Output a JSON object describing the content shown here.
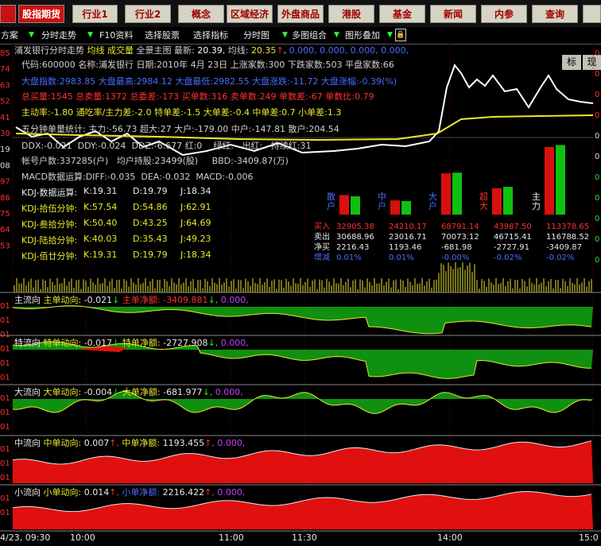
{
  "toolbar": {
    "buttons": [
      "股指期货",
      "行业1",
      "行业2",
      "概念",
      "区域经济",
      "外盘商品",
      "港股",
      "基金",
      "新闻",
      "内参",
      "查询"
    ]
  },
  "menubar": {
    "items": [
      "方案",
      "分时走势",
      "F10资料",
      "选择股票",
      "选择指标",
      "分时图",
      "多图组合",
      "图形叠加"
    ],
    "right_tabs": [
      "标",
      "现"
    ]
  },
  "chart_header": {
    "name": "浦发银行分时走势",
    "labels": [
      "均线",
      "成交量",
      "全景主图"
    ],
    "latest_label": "最新:",
    "latest": "20.39",
    "avg_label": "均线:",
    "avg": "20.35",
    "extra": "0.000, 0.000, 0.000, 0.000,"
  },
  "info_lines": {
    "l1": {
      "code_label": "代码:",
      "code": "600000",
      "name_label": "名称:",
      "name": "浦发银行",
      "date_label": "日期:",
      "date": "2010年 4月 23日",
      "up_label": "上涨家数:",
      "up": "300",
      "down_label": "下跌家数:",
      "down": "503",
      "flat_label": "平盘家数:",
      "flat": "66"
    },
    "l2": {
      "idx_label": "大盘指数:",
      "idx": "2983.85",
      "hi_label": "大盘最高:",
      "hi": "2984.12",
      "lo_label": "大盘最低:",
      "lo": "2982.55",
      "chg_label": "大盘涨跌:",
      "chg": "-11.72",
      "pct_label": "大盘涨幅:",
      "pct": "-0.39(%)"
    },
    "l3": {
      "tb_label": "总买量:",
      "tb": "1545",
      "ts_label": "总卖量:",
      "ts": "1372",
      "tc_label": "总委差:",
      "tc": "-173",
      "bc_label": "买单数:",
      "bc": "316",
      "sc_label": "卖单数:",
      "sc": "249",
      "dc_label": "单数差:",
      "dc": "-67",
      "dr_label": "单数比:",
      "dr": "0.79"
    },
    "l4": {
      "a_label": "主动率:",
      "a": "-1.80",
      "b_label": "通吃率/主力差:",
      "b": "-2.0",
      "c_label": "特单差:",
      "c": "-1.5",
      "d_label": "大单差:",
      "d": "-0.4",
      "e_label": "中单差:",
      "e": "0.7",
      "f_label": "小单差:",
      "f": "1.3"
    },
    "l5": {
      "text": "五分钟单量统计: 主力:",
      "v1": "-56.73",
      "mid": "超大:",
      "v2": "27",
      "big": "大户:",
      "v3": "-179.00",
      "midh": "中户:",
      "v4": "-147.81",
      "small": "散户:",
      "v5": "204.54"
    },
    "l6": {
      "ddx_label": "DDX:",
      "ddx": "-0.021",
      "ddy_label": "DDY:",
      "ddy": "-0.024",
      "ddz_label": "DDZ:",
      "ddz": "-6.677",
      "t1": "红:0",
      "t2": "绿红:",
      "t3": "出红:",
      "t4": "持续红:31"
    },
    "l7": {
      "acc_label": "帐号户数:",
      "acc": "337285(户)",
      "avg_label": "均户持股:",
      "avg": "23499(股)",
      "bbd_label": "BBD:",
      "bbd": "-3409.87(万)"
    },
    "l8": {
      "label": "MACD数据运算:",
      "diff_label": "DIFF:",
      "diff": "-0.035",
      "dea_label": "DEA:",
      "dea": "-0.032",
      "macd_label": "MACD:",
      "macd": "-0.006"
    },
    "kdj": [
      {
        "label": "KDJ-数据运算:",
        "k": "K:19.31",
        "d": "D:19.79",
        "j": "J:18.34"
      },
      {
        "label": "KDJ-拾伍分钟:",
        "k": "K:57.54",
        "d": "D:54.86",
        "j": "J:62.91"
      },
      {
        "label": "KDJ-叁拾分钟:",
        "k": "K:50.40",
        "d": "D:43.25",
        "j": "J:64.69"
      },
      {
        "label": "KDJ-陆拾分钟:",
        "k": "K:40.03",
        "d": "D:35.43",
        "j": "J:49.23"
      },
      {
        "label": "KDJ-佰廿分钟:",
        "k": "K:19.31",
        "d": "D:19.79",
        "j": "J:18.34"
      }
    ]
  },
  "left_axis": [
    "85",
    "74",
    "63",
    "52",
    "41",
    "30",
    "19",
    "08",
    "97",
    "86",
    "75",
    "64",
    "53"
  ],
  "right_axis": [
    "0",
    "0",
    "0",
    "0",
    "0",
    "0",
    "0",
    "0",
    "0",
    "0",
    "0"
  ],
  "flow_summary": {
    "groups": [
      "散户",
      "中户",
      "大户",
      "超大",
      "主力"
    ],
    "rows": [
      {
        "label": "买入",
        "values": [
          "32905.38",
          "24210.17",
          "68791.14",
          "43987.50",
          "113378.65"
        ]
      },
      {
        "label": "卖出",
        "values": [
          "30688.96",
          "23016.71",
          "70073.12",
          "46715.41",
          "116788.52"
        ]
      },
      {
        "label": "净买",
        "values": [
          "2216.43",
          "1193.46",
          "-681.98",
          "-2727.91",
          "-3409.87"
        ]
      },
      {
        "label": "增减",
        "values": [
          "0.01%",
          "0.01%",
          "-0.00%",
          "-0.02%",
          "-0.02%"
        ]
      }
    ],
    "bars": [
      {
        "name": "散户",
        "buy": 0.29,
        "sell": 0.27
      },
      {
        "name": "中户",
        "buy": 0.21,
        "sell": 0.2
      },
      {
        "name": "大户",
        "buy": 0.61,
        "sell": 0.62
      },
      {
        "name": "超大",
        "buy": 0.39,
        "sell": 0.41
      },
      {
        "name": "主力",
        "buy": 1.0,
        "sell": 1.03
      }
    ]
  },
  "panels": [
    {
      "title": "主流向",
      "l1": "主单动向:",
      "v1": "-0.021",
      "l2": "主单净额:",
      "v2": "-3409.881",
      "v3": "0.000,",
      "axis": [
        "01",
        "01",
        "01"
      ]
    },
    {
      "title": "特流向",
      "l1": "特单动向:",
      "v1": "-0.017",
      "l2": "特单净额:",
      "v2": "-2727.908",
      "v3": "0.000,",
      "axis": [
        "01",
        "01",
        "01"
      ]
    },
    {
      "title": "大流向",
      "l1": "大单动向:",
      "v1": "-0.004",
      "l2": "大单净额:",
      "v2": "-681.977",
      "v3": "0.000,",
      "axis": [
        "01",
        "01",
        "01"
      ]
    },
    {
      "title": "中流向",
      "l1": "中单动向:",
      "v1": "0.007",
      "l2": "中单净额:",
      "v2": "1193.455",
      "v3": "0.000,",
      "axis": [
        "01",
        "01",
        "01"
      ]
    },
    {
      "title": "小流向",
      "l1": "小单动向:",
      "v1": "0.014",
      "l2": "小单净额:",
      "v2": "2216.422",
      "v3": "0.000,",
      "axis": [
        "01",
        "01"
      ]
    }
  ],
  "time_axis": [
    "4/23, 09:30",
    "10:00",
    "11:00",
    "11:30",
    "14:00",
    "15:0"
  ],
  "colors": {
    "up": "#ff2020",
    "down": "#10a010",
    "bg": "#000000",
    "price": "#ffffff",
    "avg": "#e8e830"
  }
}
